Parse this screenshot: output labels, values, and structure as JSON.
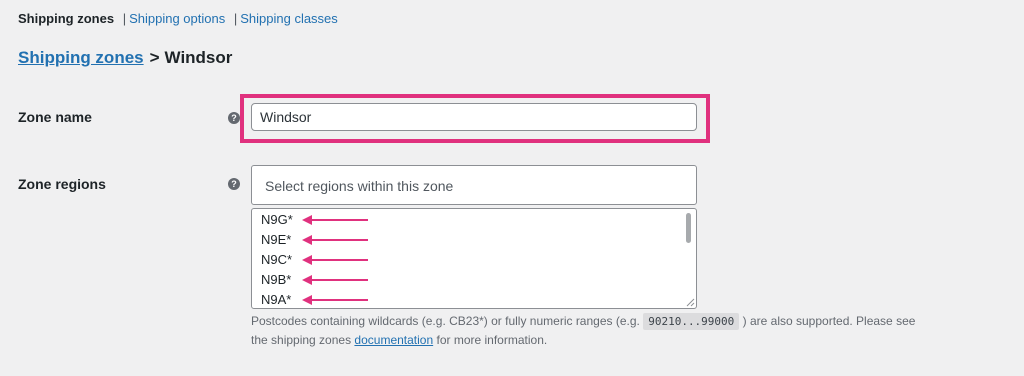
{
  "subnav": {
    "current": "Shipping zones",
    "separator": "|",
    "links": [
      "Shipping options",
      "Shipping classes"
    ]
  },
  "breadcrumb": {
    "parent": "Shipping zones",
    "separator": ">",
    "current": "Windsor"
  },
  "zone_name": {
    "label": "Zone name",
    "help_icon": "help-icon",
    "value": "Windsor"
  },
  "zone_regions": {
    "label": "Zone regions",
    "help_icon": "help-icon",
    "placeholder": "Select regions within this zone",
    "postcodes": [
      "N9G*",
      "N9E*",
      "N9C*",
      "N9B*",
      "N9A*"
    ],
    "help_text": {
      "part1": "Postcodes containing wildcards (e.g. CB23*) or fully numeric ranges (e.g.",
      "code": "90210...99000",
      "part2": ") are also supported. Please see",
      "part3": "the shipping zones",
      "link": "documentation",
      "part4": "for more information."
    }
  },
  "colors": {
    "highlight": "#e0317e",
    "arrow": "#e0317e",
    "link": "#2271b1",
    "background": "#f0f0f1"
  }
}
